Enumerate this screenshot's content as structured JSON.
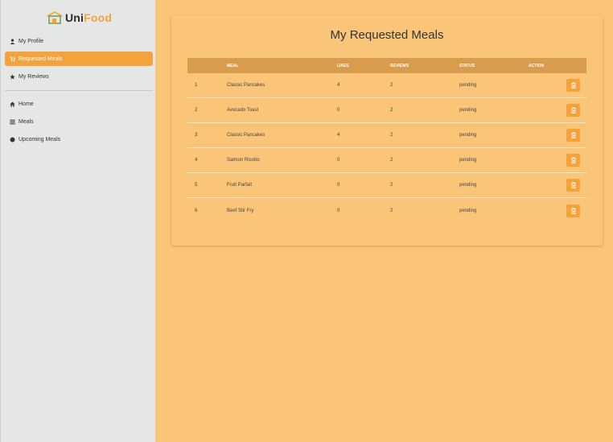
{
  "app": {
    "logo_uni": "Uni",
    "logo_food": "Food"
  },
  "sidebar": {
    "top_items": [
      {
        "label": "My Profile",
        "icon": "user-icon",
        "active": false
      },
      {
        "label": "Requested Meals",
        "icon": "cart-icon",
        "active": true
      },
      {
        "label": "My Reviews",
        "icon": "star-icon",
        "active": false
      }
    ],
    "bottom_items": [
      {
        "label": "Home",
        "icon": "home-icon"
      },
      {
        "label": "Meals",
        "icon": "list-icon"
      },
      {
        "label": "Upcoming Meals",
        "icon": "circle-icon"
      }
    ]
  },
  "main": {
    "title": "My Requested Meals",
    "columns": [
      "",
      "MEAL",
      "LIKES",
      "REVIEWS",
      "STATUS",
      "ACTION"
    ],
    "rows": [
      {
        "n": "1",
        "meal": "Classic Pancakes",
        "likes": "4",
        "reviews": "2",
        "status": "pending"
      },
      {
        "n": "2",
        "meal": "Avocado Toast",
        "likes": "0",
        "reviews": "2",
        "status": "pending"
      },
      {
        "n": "3",
        "meal": "Classic Pancakes",
        "likes": "4",
        "reviews": "2",
        "status": "pending"
      },
      {
        "n": "4",
        "meal": "Salmon Risotto",
        "likes": "0",
        "reviews": "2",
        "status": "pending"
      },
      {
        "n": "5",
        "meal": "Fruit Parfait",
        "likes": "0",
        "reviews": "2",
        "status": "pending"
      },
      {
        "n": "6",
        "meal": "Beef Stir Fry",
        "likes": "0",
        "reviews": "2",
        "status": "pending"
      }
    ],
    "action_icon": "trash-icon"
  },
  "colors": {
    "accent": "#f4a23b",
    "background": "#fac479",
    "sidebar": "#e5e6e6",
    "table_header": "#d89c4c"
  }
}
